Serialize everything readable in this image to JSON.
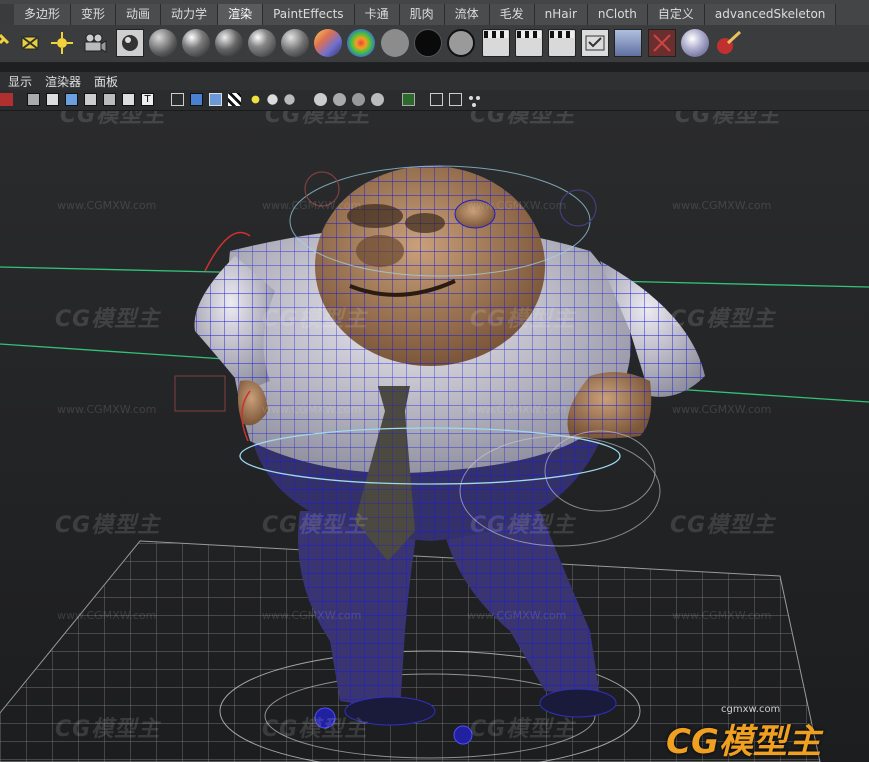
{
  "shelf": {
    "tabs": [
      "多边形",
      "变形",
      "动画",
      "动力学",
      "渲染",
      "PaintEffects",
      "卡通",
      "肌肉",
      "流体",
      "毛发",
      "nHair",
      "nCloth",
      "自定义",
      "advancedSkeleton"
    ],
    "active_tab": "渲染",
    "icons": [
      "select-icon",
      "light-icon",
      "sun-icon",
      "camera-icon",
      "render-view-icon",
      "lambert-sphere-icon",
      "blinn-sphere-icon",
      "phong-sphere-icon",
      "phongE-sphere-icon",
      "anisotropic-sphere-icon",
      "ramp-shader-icon",
      "rainbow-sphere-icon",
      "gray-swatch-icon",
      "black-swatch-icon",
      "gray-ring-swatch-icon",
      "render-clapper-icon",
      "ipr-clapper-icon",
      "batch-clapper-icon",
      "render-settings-icon",
      "hypershade-icon",
      "render-region-icon",
      "mental-ray-icon",
      "paint-brush-icon"
    ]
  },
  "panel": {
    "menus": [
      "显示",
      "渲染器",
      "面板"
    ]
  },
  "watermark": {
    "logo_text": "CG模型主",
    "url": "www.CGMXW.com",
    "brand_name": "CG模型主",
    "brand_url": "cgmxw.com"
  },
  "colors": {
    "axis_green": "#33c27a",
    "wireframe_blue": "#1b1bd8",
    "shirt": "#d9d7e0",
    "skin": "#b88a66",
    "pants": "#3a3570",
    "brand_orange": "#f0a020"
  }
}
